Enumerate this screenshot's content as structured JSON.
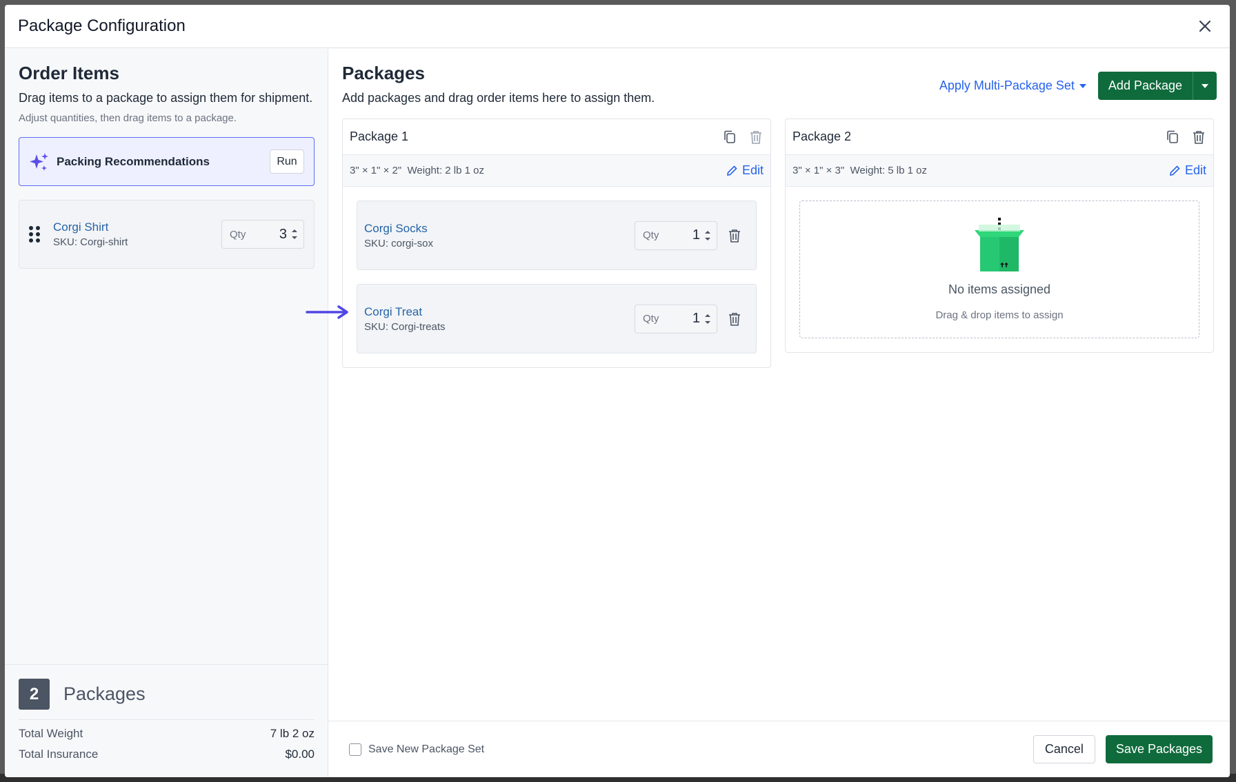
{
  "modal": {
    "title": "Package Configuration"
  },
  "order_items": {
    "title": "Order Items",
    "subtitle": "Drag items to a package to assign them for shipment.",
    "hint": "Adjust quantities, then drag items to a package.",
    "recommendations": {
      "label": "Packing Recommendations",
      "run_label": "Run"
    },
    "items": [
      {
        "name": "Corgi Shirt",
        "sku": "SKU: Corgi-shirt",
        "qty_label": "Qty",
        "qty": "3"
      }
    ]
  },
  "summary": {
    "count": "2",
    "count_label": "Packages",
    "total_weight_label": "Total Weight",
    "total_weight": "7 lb 2 oz",
    "total_insurance_label": "Total Insurance",
    "total_insurance": "$0.00"
  },
  "packages": {
    "title": "Packages",
    "subtitle": "Add packages and drag order items here to assign them.",
    "apply_set_label": "Apply Multi-Package Set",
    "add_label": "Add Package",
    "list": [
      {
        "name": "Package 1",
        "dims": "3\" × 1\" × 2\"",
        "weight": "Weight: 2 lb 1 oz",
        "edit_label": "Edit",
        "items": [
          {
            "name": "Corgi Socks",
            "sku": "SKU: corgi-sox",
            "qty_label": "Qty",
            "qty": "1"
          },
          {
            "name": "Corgi Treat",
            "sku": "SKU: Corgi-treats",
            "qty_label": "Qty",
            "qty": "1"
          }
        ]
      },
      {
        "name": "Package 2",
        "dims": "3\" × 1\" × 3\"",
        "weight": "Weight: 5 lb 1 oz",
        "edit_label": "Edit",
        "empty_title": "No items assigned",
        "empty_sub": "Drag & drop items to assign"
      }
    ]
  },
  "footer": {
    "save_set_label": "Save New Package Set",
    "cancel_label": "Cancel",
    "save_label": "Save Packages"
  },
  "colors": {
    "primary_green": "#0f6b3c",
    "link_blue": "#2563eb",
    "accent_purple": "#5b4ee8"
  }
}
